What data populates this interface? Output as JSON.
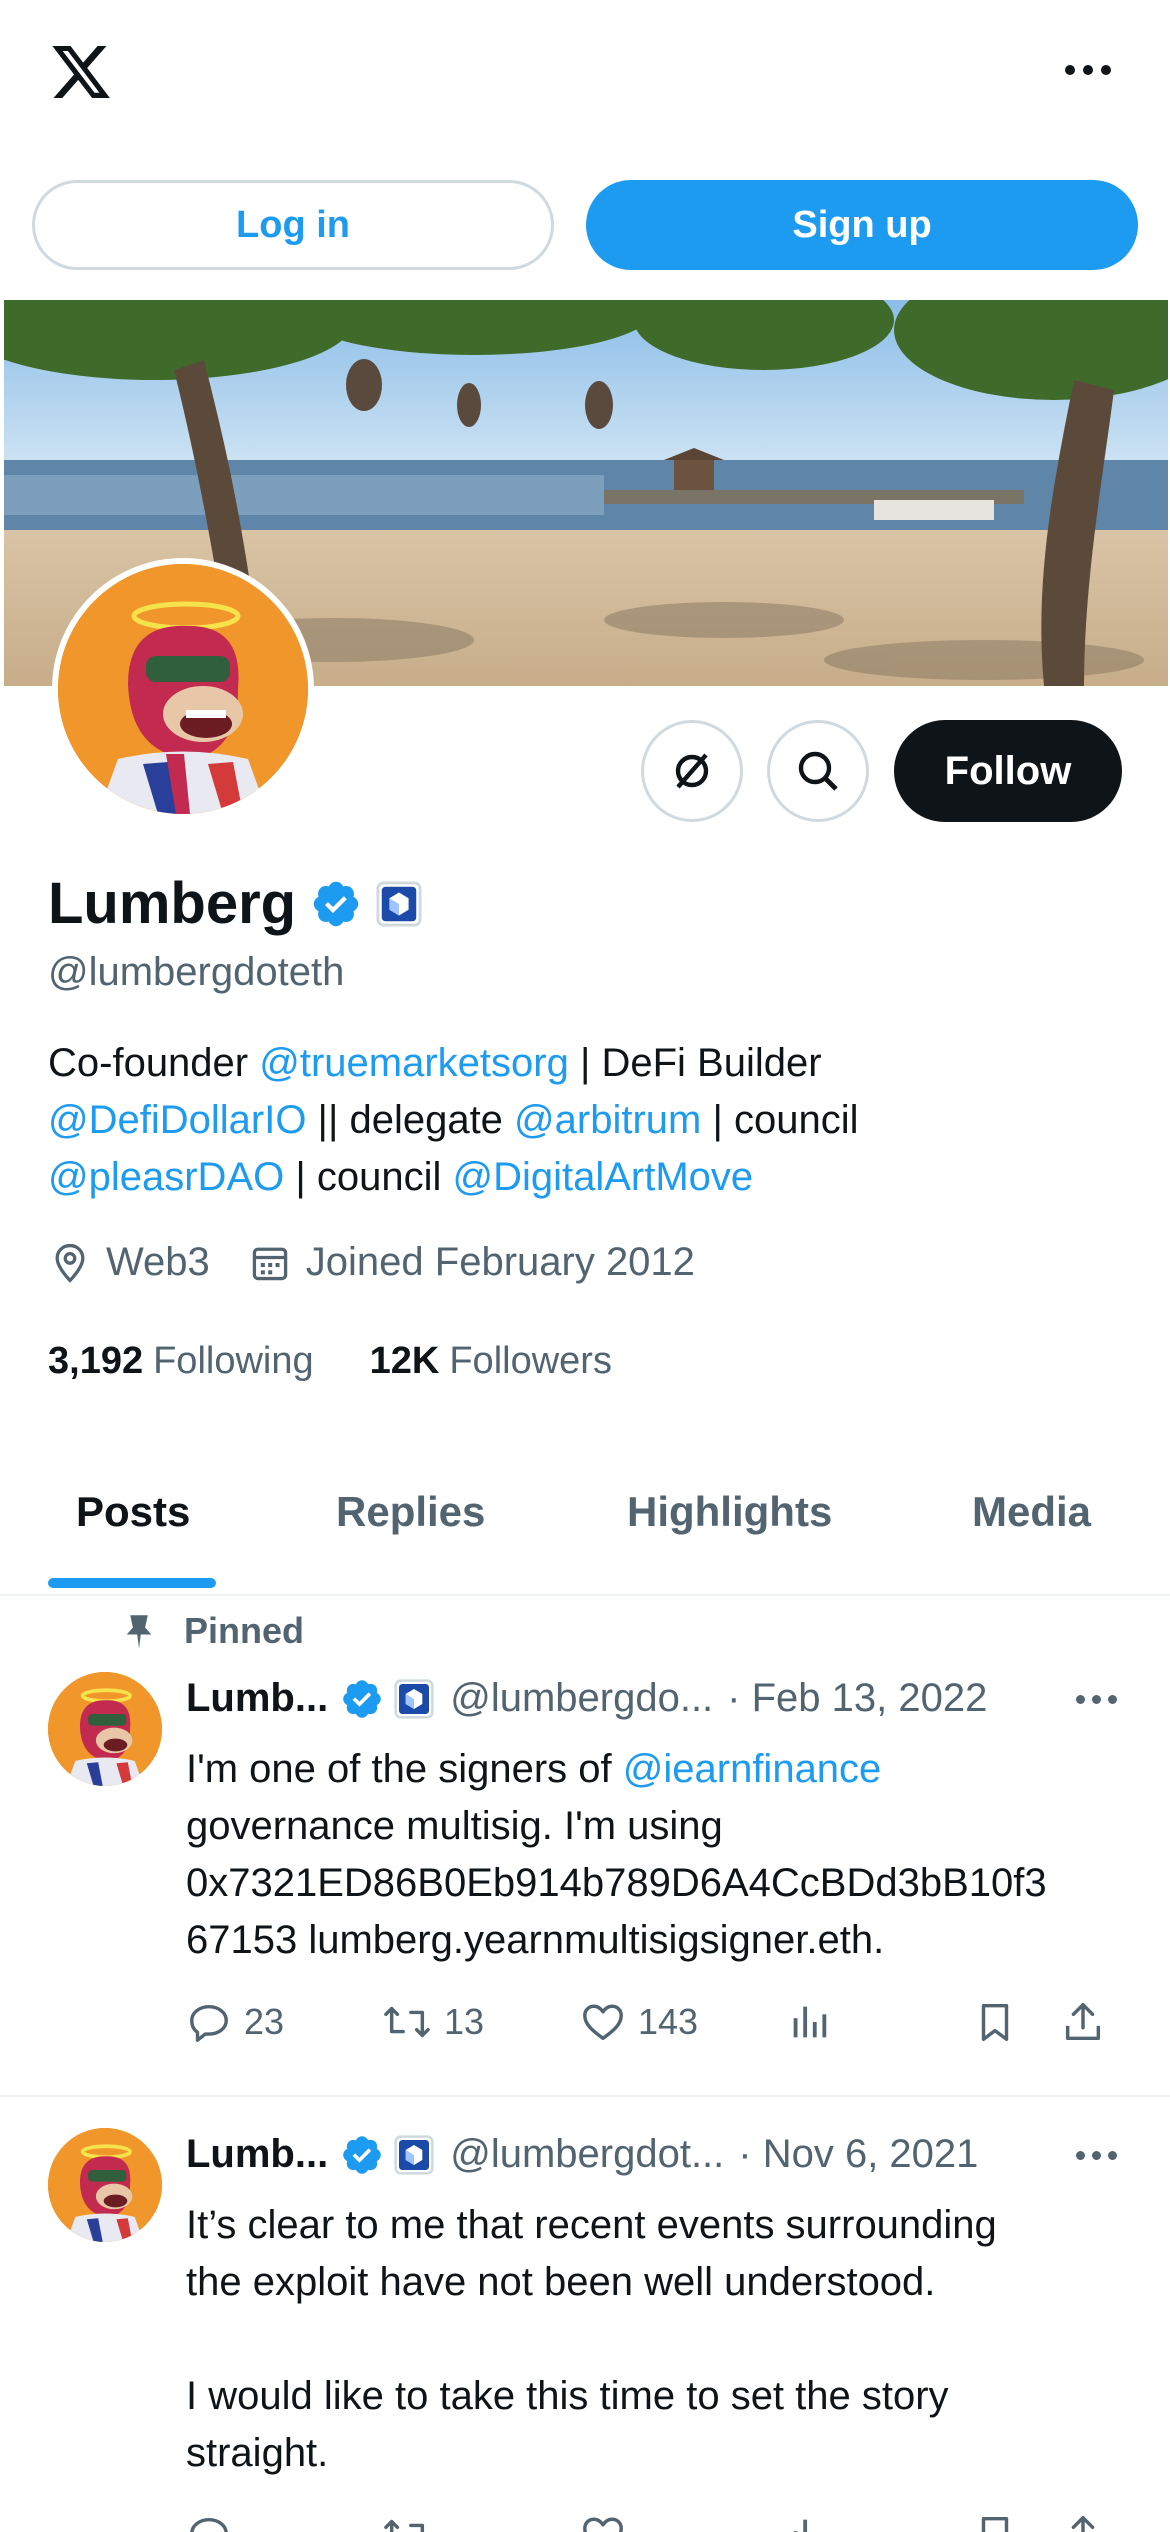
{
  "topbar": {
    "logo": "x-logo-icon",
    "more": "more-icon"
  },
  "auth": {
    "login_label": "Log in",
    "signup_label": "Sign up"
  },
  "profile": {
    "name": "Lumberg",
    "handle": "@lumbergdoteth",
    "follow_label": "Follow",
    "bio": {
      "line1_prefix": "Co-founder ",
      "line1_link": "@truemarketsorg",
      "line1_suffix": " | DeFi Builder",
      "line2_link1": "@DefiDollarIO",
      "line2_mid": " || delegate ",
      "line2_link2": "@arbitrum",
      "line2_suffix": " | council",
      "line3_link1": "@pleasrDAO",
      "line3_mid": " | council ",
      "line3_link2": "@DigitalArtMove"
    },
    "location": "Web3",
    "joined": "Joined February 2012",
    "following_count": "3,192",
    "following_label": "Following",
    "followers_count": "12K",
    "followers_label": "Followers"
  },
  "tabs": [
    {
      "label": "Posts",
      "active": true
    },
    {
      "label": "Replies",
      "active": false
    },
    {
      "label": "Highlights",
      "active": false
    },
    {
      "label": "Media",
      "active": false
    }
  ],
  "pinned_label": "Pinned",
  "tweets": [
    {
      "name": "Lumb...",
      "handle": "@lumbergdo...",
      "date": "· Feb 13, 2022",
      "body_prefix": "I'm one of the signers of ",
      "body_link": "@iearnfinance",
      "body_rest1": "governance multisig. I'm using",
      "body_rest2": "0x7321ED86B0Eb914b789D6A4CcBDd3bB10f3",
      "body_rest3": "67153 lumberg.yearnmultisigsigner.eth.",
      "replies": "23",
      "reposts": "13",
      "likes": "143"
    },
    {
      "name": "Lumb...",
      "handle": "@lumbergdot...",
      "date": "· Nov 6, 2021",
      "body_line1": "It’s clear to me that recent events surrounding",
      "body_line2": "the exploit have not been well understood.",
      "body_line3": "I would like to take this time to set the story",
      "body_line4": "straight."
    }
  ],
  "colors": {
    "accent": "#1d9bf0",
    "text": "#0f1419",
    "muted": "#536471",
    "avatar_bg": "#f0962b"
  }
}
